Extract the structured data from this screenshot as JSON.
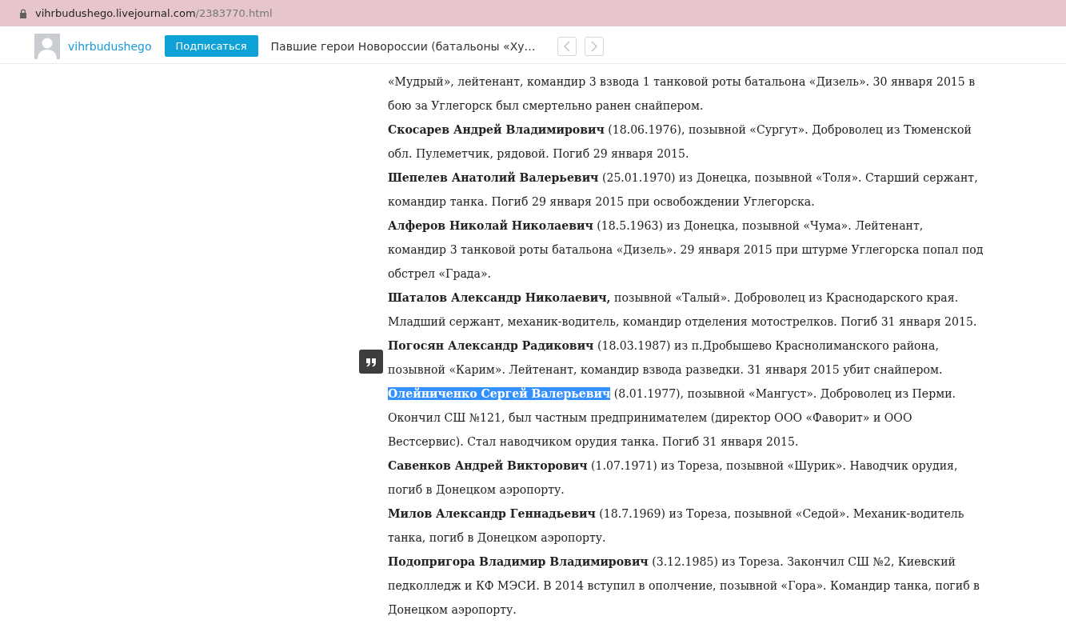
{
  "address_bar": {
    "host": "vihrbudushego.livejournal.com",
    "path": "/2383770.html"
  },
  "header": {
    "username": "vihrbudushego",
    "subscribe_button": "Подписаться",
    "post_title": "Павшие герои Новороссии (батальоны «Ху…"
  },
  "paragraphs": [
    {
      "text": "«Мудрый», лейтенант, командир 3 взвода 1 танковой роты батальона «Дизель». 30 января 2015 в бою за Углегорск был смертельно ранен снайпером.",
      "selected": false
    },
    {
      "name": "Скосарев Андрей Владимирович",
      "text": " (18.06.1976), позывной «Сургут». Доброволец из Тюменской обл. Пулеметчик, рядовой. Погиб 29 января 2015.",
      "selected": false
    },
    {
      "name": "Шепелев Анатолий Валерьевич",
      "text": " (25.01.1970) из Донецка, позывной «Толя». Старший сержант, командир танка. Погиб 29 января 2015 при освобождении Углегорска.",
      "selected": false
    },
    {
      "name": "Алферов Николай Николаевич",
      "text": " (18.5.1963) из Донецка, позывной «Чума». Лейтенант, командир 3 танковой роты батальона «Дизель». 29 января 2015 при штурме Углегорска попал под обстрел «Града».",
      "selected": false
    },
    {
      "name": "Шаталов Александр Николаевич,",
      "text": " позывной «Талый». Доброволец из Краснодарского края. Младший сержант, механик-водитель, командир отделения мотострелков. Погиб 31 января 2015.",
      "selected": false
    },
    {
      "name": "Погосян Александр Радикович",
      "text": " (18.03.1987) из п.Дробышево Краснолиманского района, позывной «Карим». Лейтенант, командир взвода разведки. 31 января 2015 убит снайпером.",
      "selected": false
    },
    {
      "name": "Олейниченко Сергей Валерьевич",
      "text": " (8.01.1977), позывной «Мангуст». Доброволец из Перми. Окончил СШ №121, был частным предпринимателем (директор ООО «Фаворит» и ООО Вестсервис). Стал наводчиком орудия танка. Погиб 31 января 2015.",
      "selected": true
    },
    {
      "name": "Савенков Андрей Викторович",
      "text": " (1.07.1971) из Тореза, позывной «Шурик». Наводчик орудия, погиб в Донецком аэропорту.",
      "selected": false
    },
    {
      "name": "Милов Александр Геннадьевич",
      "text": " (18.7.1969) из Тореза, позывной «Седой». Механик-водитель танка, погиб в Донецком аэропорту.",
      "selected": false
    },
    {
      "name": "Подопригора Владимир Владимирович",
      "text": " (3.12.1985) из Тореза. Закончил СШ №2, Киевский педколледж и КФ МЭСИ. В 2014 вступил в ополчение, позывной «Гора». Командир танка, погиб в Донецком аэропорту.",
      "selected": false
    }
  ]
}
